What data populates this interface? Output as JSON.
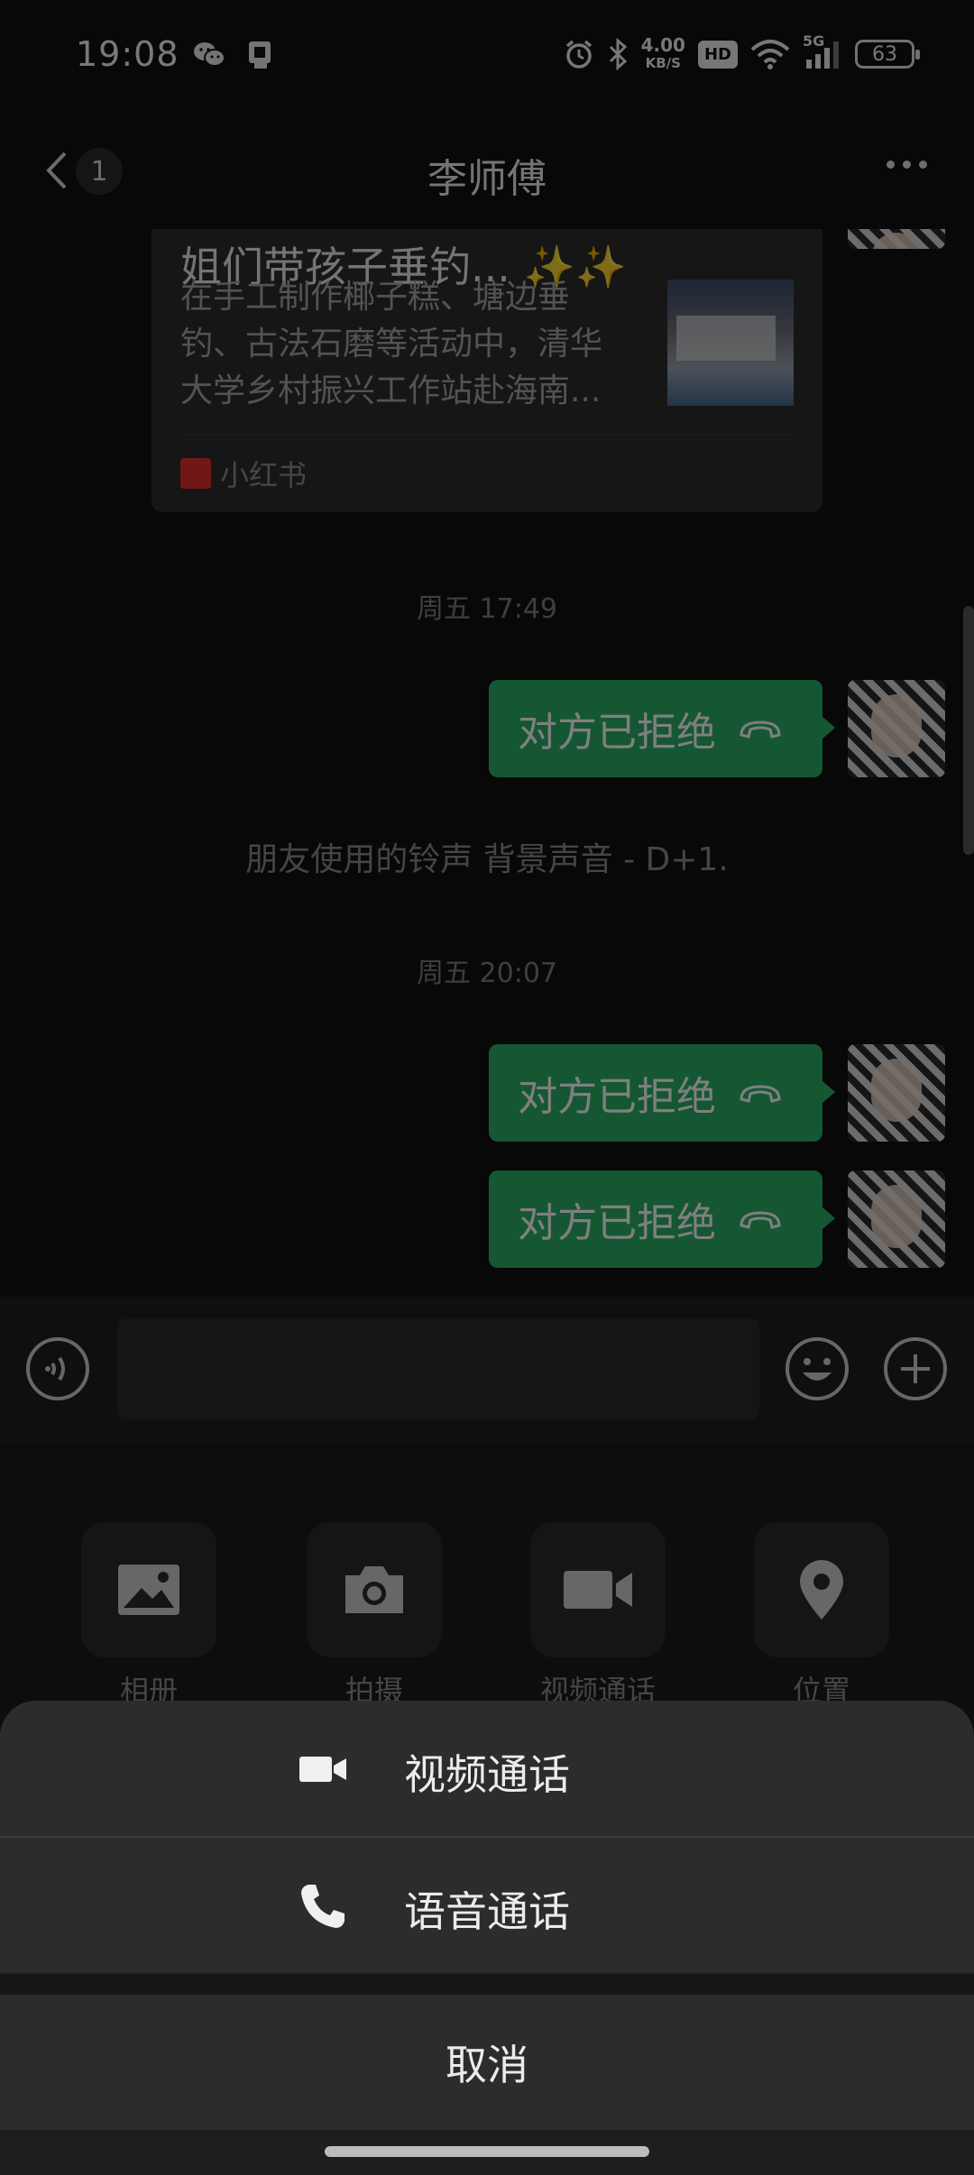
{
  "status_bar": {
    "time": "19:08",
    "net_speed": "4.00",
    "net_unit": "KB/S",
    "hd_label": "HD",
    "signal_label": "5G",
    "battery": "63",
    "icons": [
      "wechat-icon",
      "sim-icon",
      "alarm-icon",
      "bluetooth-icon",
      "wifi-icon",
      "signal-icon",
      "battery-icon"
    ]
  },
  "header": {
    "title": "李师傅",
    "unread_count": "1"
  },
  "chat": {
    "card": {
      "title": "姐们带孩子垂钓... ✨✨",
      "description": "在手工制作椰子糕、塘边垂钓、古法石磨等活动中，清华大学乡村振兴工作站赴海南...",
      "source": "小红书"
    },
    "timestamp_1": "周五 17:49",
    "message_1": "对方已拒绝",
    "system_note": "朋友使用的铃声 背景声音 - D+1.",
    "timestamp_2": "周五 20:07",
    "message_2": "对方已拒绝",
    "message_3": "对方已拒绝"
  },
  "panel": {
    "items": [
      {
        "label": "相册",
        "icon": "photo-icon"
      },
      {
        "label": "拍摄",
        "icon": "camera-icon"
      },
      {
        "label": "视频通话",
        "icon": "video-icon"
      },
      {
        "label": "位置",
        "icon": "location-icon"
      }
    ]
  },
  "action_sheet": {
    "video_call": "视频通话",
    "voice_call": "语音通话",
    "cancel": "取消"
  },
  "colors": {
    "bubble": "#2aae67",
    "background": "#111111",
    "sheet": "#2c2c2c"
  }
}
